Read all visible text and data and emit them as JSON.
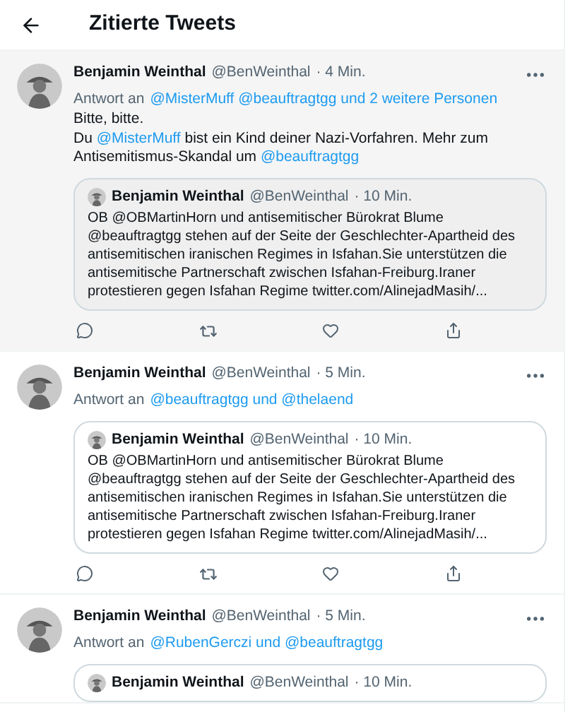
{
  "header": {
    "title": "Zitierte Tweets"
  },
  "tweets": [
    {
      "highlighted": true,
      "name": "Benjamin Weinthal",
      "handle": "@BenWeinthal",
      "time": "· 4 Min.",
      "reply_prefix": "Antwort an",
      "reply_to": "@MisterMuff @beauftragtgg und 2 weitere Personen",
      "body": [
        [
          {
            "kind": "text",
            "text": "Bitte, bitte."
          }
        ],
        [
          {
            "kind": "text",
            "text": "Du "
          },
          {
            "kind": "mention",
            "text": "@MisterMuff"
          },
          {
            "kind": "text",
            "text": " bist ein Kind deiner Nazi-Vorfahren. Mehr zum Antisemitismus-Skandal um "
          },
          {
            "kind": "mention",
            "text": "@beauftragtgg"
          }
        ]
      ],
      "quote": {
        "name": "Benjamin Weinthal",
        "handle": "@BenWeinthal",
        "time": "· 10 Min.",
        "text": "OB @OBMartinHorn und antisemitischer Bürokrat Blume @beauftragtgg stehen auf der Seite der Geschlechter-Apartheid des antisemitischen iranischen Regimes in Isfahan.Sie unterstützen die antisemitische Partnerschaft zwischen Isfahan-Freiburg.Iraner protestieren gegen Isfahan Regime twitter.com/AlinejadMasih/..."
      }
    },
    {
      "highlighted": false,
      "name": "Benjamin Weinthal",
      "handle": "@BenWeinthal",
      "time": "· 5 Min.",
      "reply_prefix": "Antwort an",
      "reply_to": "@beauftragtgg und @thelaend",
      "quote": {
        "name": "Benjamin Weinthal",
        "handle": "@BenWeinthal",
        "time": "· 10 Min.",
        "text": "OB @OBMartinHorn und antisemitischer Bürokrat Blume @beauftragtgg stehen auf der Seite der Geschlechter-Apartheid des antisemitischen iranischen Regimes in Isfahan.Sie unterstützen die antisemitische Partnerschaft zwischen Isfahan-Freiburg.Iraner protestieren gegen Isfahan Regime twitter.com/AlinejadMasih/..."
      }
    },
    {
      "highlighted": false,
      "name": "Benjamin Weinthal",
      "handle": "@BenWeinthal",
      "time": "· 5 Min.",
      "reply_prefix": "Antwort an",
      "reply_to": "@RubenGerczi und @beauftragtgg",
      "quote": {
        "name": "Benjamin Weinthal",
        "handle": "@BenWeinthal",
        "time": "· 10 Min."
      }
    }
  ]
}
